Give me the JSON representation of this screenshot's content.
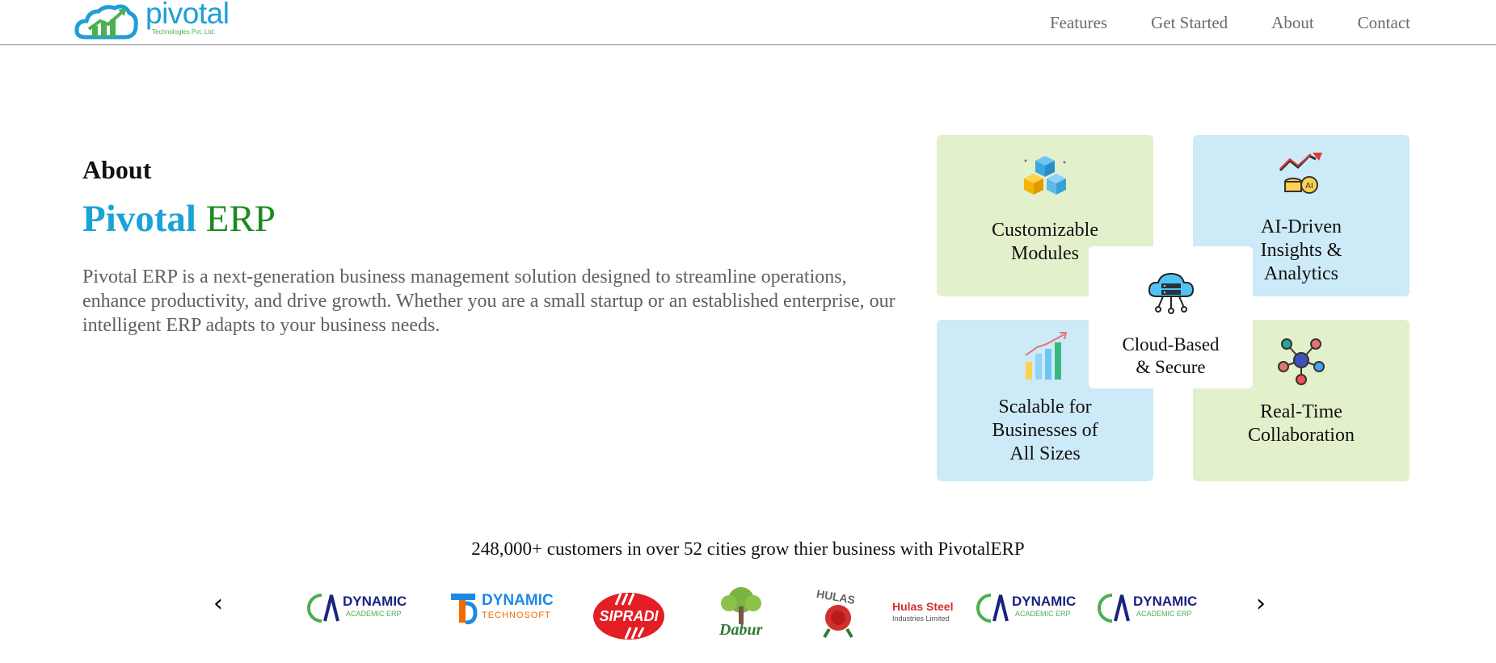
{
  "header": {
    "logo_word": "pivotal",
    "logo_sub": "Technologies Pvt. Ltd.",
    "nav": [
      "Features",
      "Get Started",
      "About",
      "Contact"
    ]
  },
  "about": {
    "heading": "About",
    "title_part1": "Pivotal",
    "title_part2": "ERP",
    "description": "Pivotal ERP is a next-generation business management solution designed to streamline operations, enhance productivity, and drive growth. Whether you are a small startup or an established enterprise, our intelligent ERP adapts to your business needs."
  },
  "features": {
    "customizable": [
      "Customizable",
      "Modules"
    ],
    "ai": [
      "AI-Driven",
      "Insights &",
      "Analytics"
    ],
    "cloud": [
      "Cloud-Based",
      "& Secure"
    ],
    "scalable": [
      "Scalable for",
      "Businesses of",
      "All Sizes"
    ],
    "realtime": [
      "Real-Time",
      "Collaboration"
    ]
  },
  "customers": {
    "text": "248,000+ customers in over 52 cities grow thier business with PivotalERP",
    "brands": [
      {
        "line1": "DYNAMIC",
        "line2": "ACADEMIC ERP"
      },
      {
        "line1": "DYNAMIC",
        "line2": "TECHNOSOFT"
      },
      {
        "line1": "SIPRADI"
      },
      {
        "line1": "Dabur"
      },
      {
        "line1": "HULAS"
      },
      {
        "line1": "Hulas Steel",
        "line2": "Industries Limited"
      },
      {
        "line1": "DYNAMIC",
        "line2": "ACADEMIC ERP"
      },
      {
        "line1": "DYNAMIC",
        "line2": "ACADEMIC ERP"
      }
    ],
    "prev": "‹",
    "next": "›"
  },
  "colors": {
    "brand_blue": "#1aa3d6",
    "brand_green": "#1c8a1c",
    "card_green": "#e3f0cc",
    "card_blue": "#cdeaf8"
  }
}
